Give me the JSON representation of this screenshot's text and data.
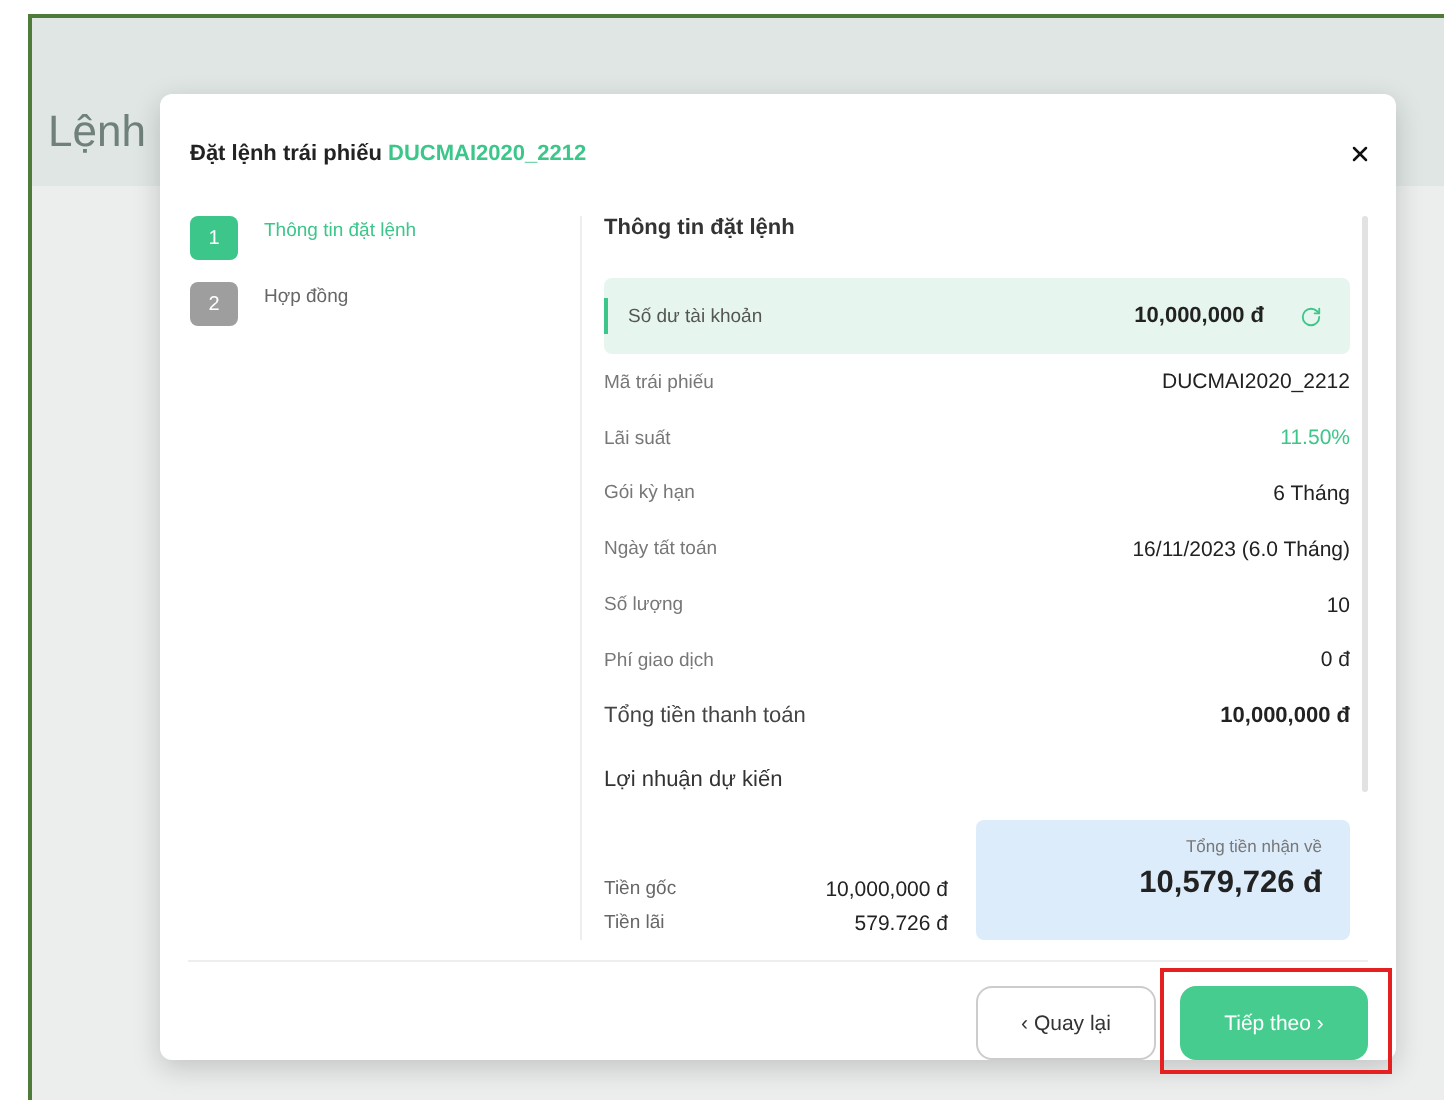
{
  "background": {
    "title": "Lệnh"
  },
  "modal": {
    "title": "Đặt lệnh trái phiếu",
    "code": "DUCMAI2020_2212"
  },
  "steps": [
    {
      "number": "1",
      "label": "Thông tin đặt lệnh",
      "selected": true
    },
    {
      "number": "2",
      "label": "Hợp đồng",
      "selected": false
    }
  ],
  "section_title": "Thông tin đặt lệnh",
  "balance": {
    "label": "Số dư tài khoản",
    "value": "10,000,000 đ"
  },
  "rows": [
    {
      "label": "Mã trái phiếu",
      "value": "DUCMAI2020_2212",
      "kind": "plain"
    },
    {
      "label": "Lãi suất",
      "value": "11.50%",
      "kind": "accent"
    },
    {
      "label": "Gói kỳ hạn",
      "value": "6 Tháng",
      "kind": "plain"
    },
    {
      "label": "Ngày tất toán",
      "value": "16/11/2023 (6.0 Tháng)",
      "kind": "plain"
    },
    {
      "label": "Số lượng",
      "value": "10",
      "kind": "plain"
    },
    {
      "label": "Phí giao dịch",
      "value": "0 đ",
      "kind": "plain"
    },
    {
      "label": "Tổng tiền thanh toán",
      "value": "10,000,000 đ",
      "kind": "total"
    }
  ],
  "profit": {
    "title": "Lợi nhuận dự kiến",
    "items": [
      {
        "label": "Tiền gốc",
        "value": "10,000,000 đ"
      },
      {
        "label": "Tiền lãi",
        "value": "579.726 đ"
      }
    ],
    "total_label": "Tổng tiền nhận về",
    "total_value": "10,579,726 đ"
  },
  "buttons": {
    "back": "‹ Quay lại",
    "next": "Tiếp theo ›",
    "next_highlighted": true
  }
}
